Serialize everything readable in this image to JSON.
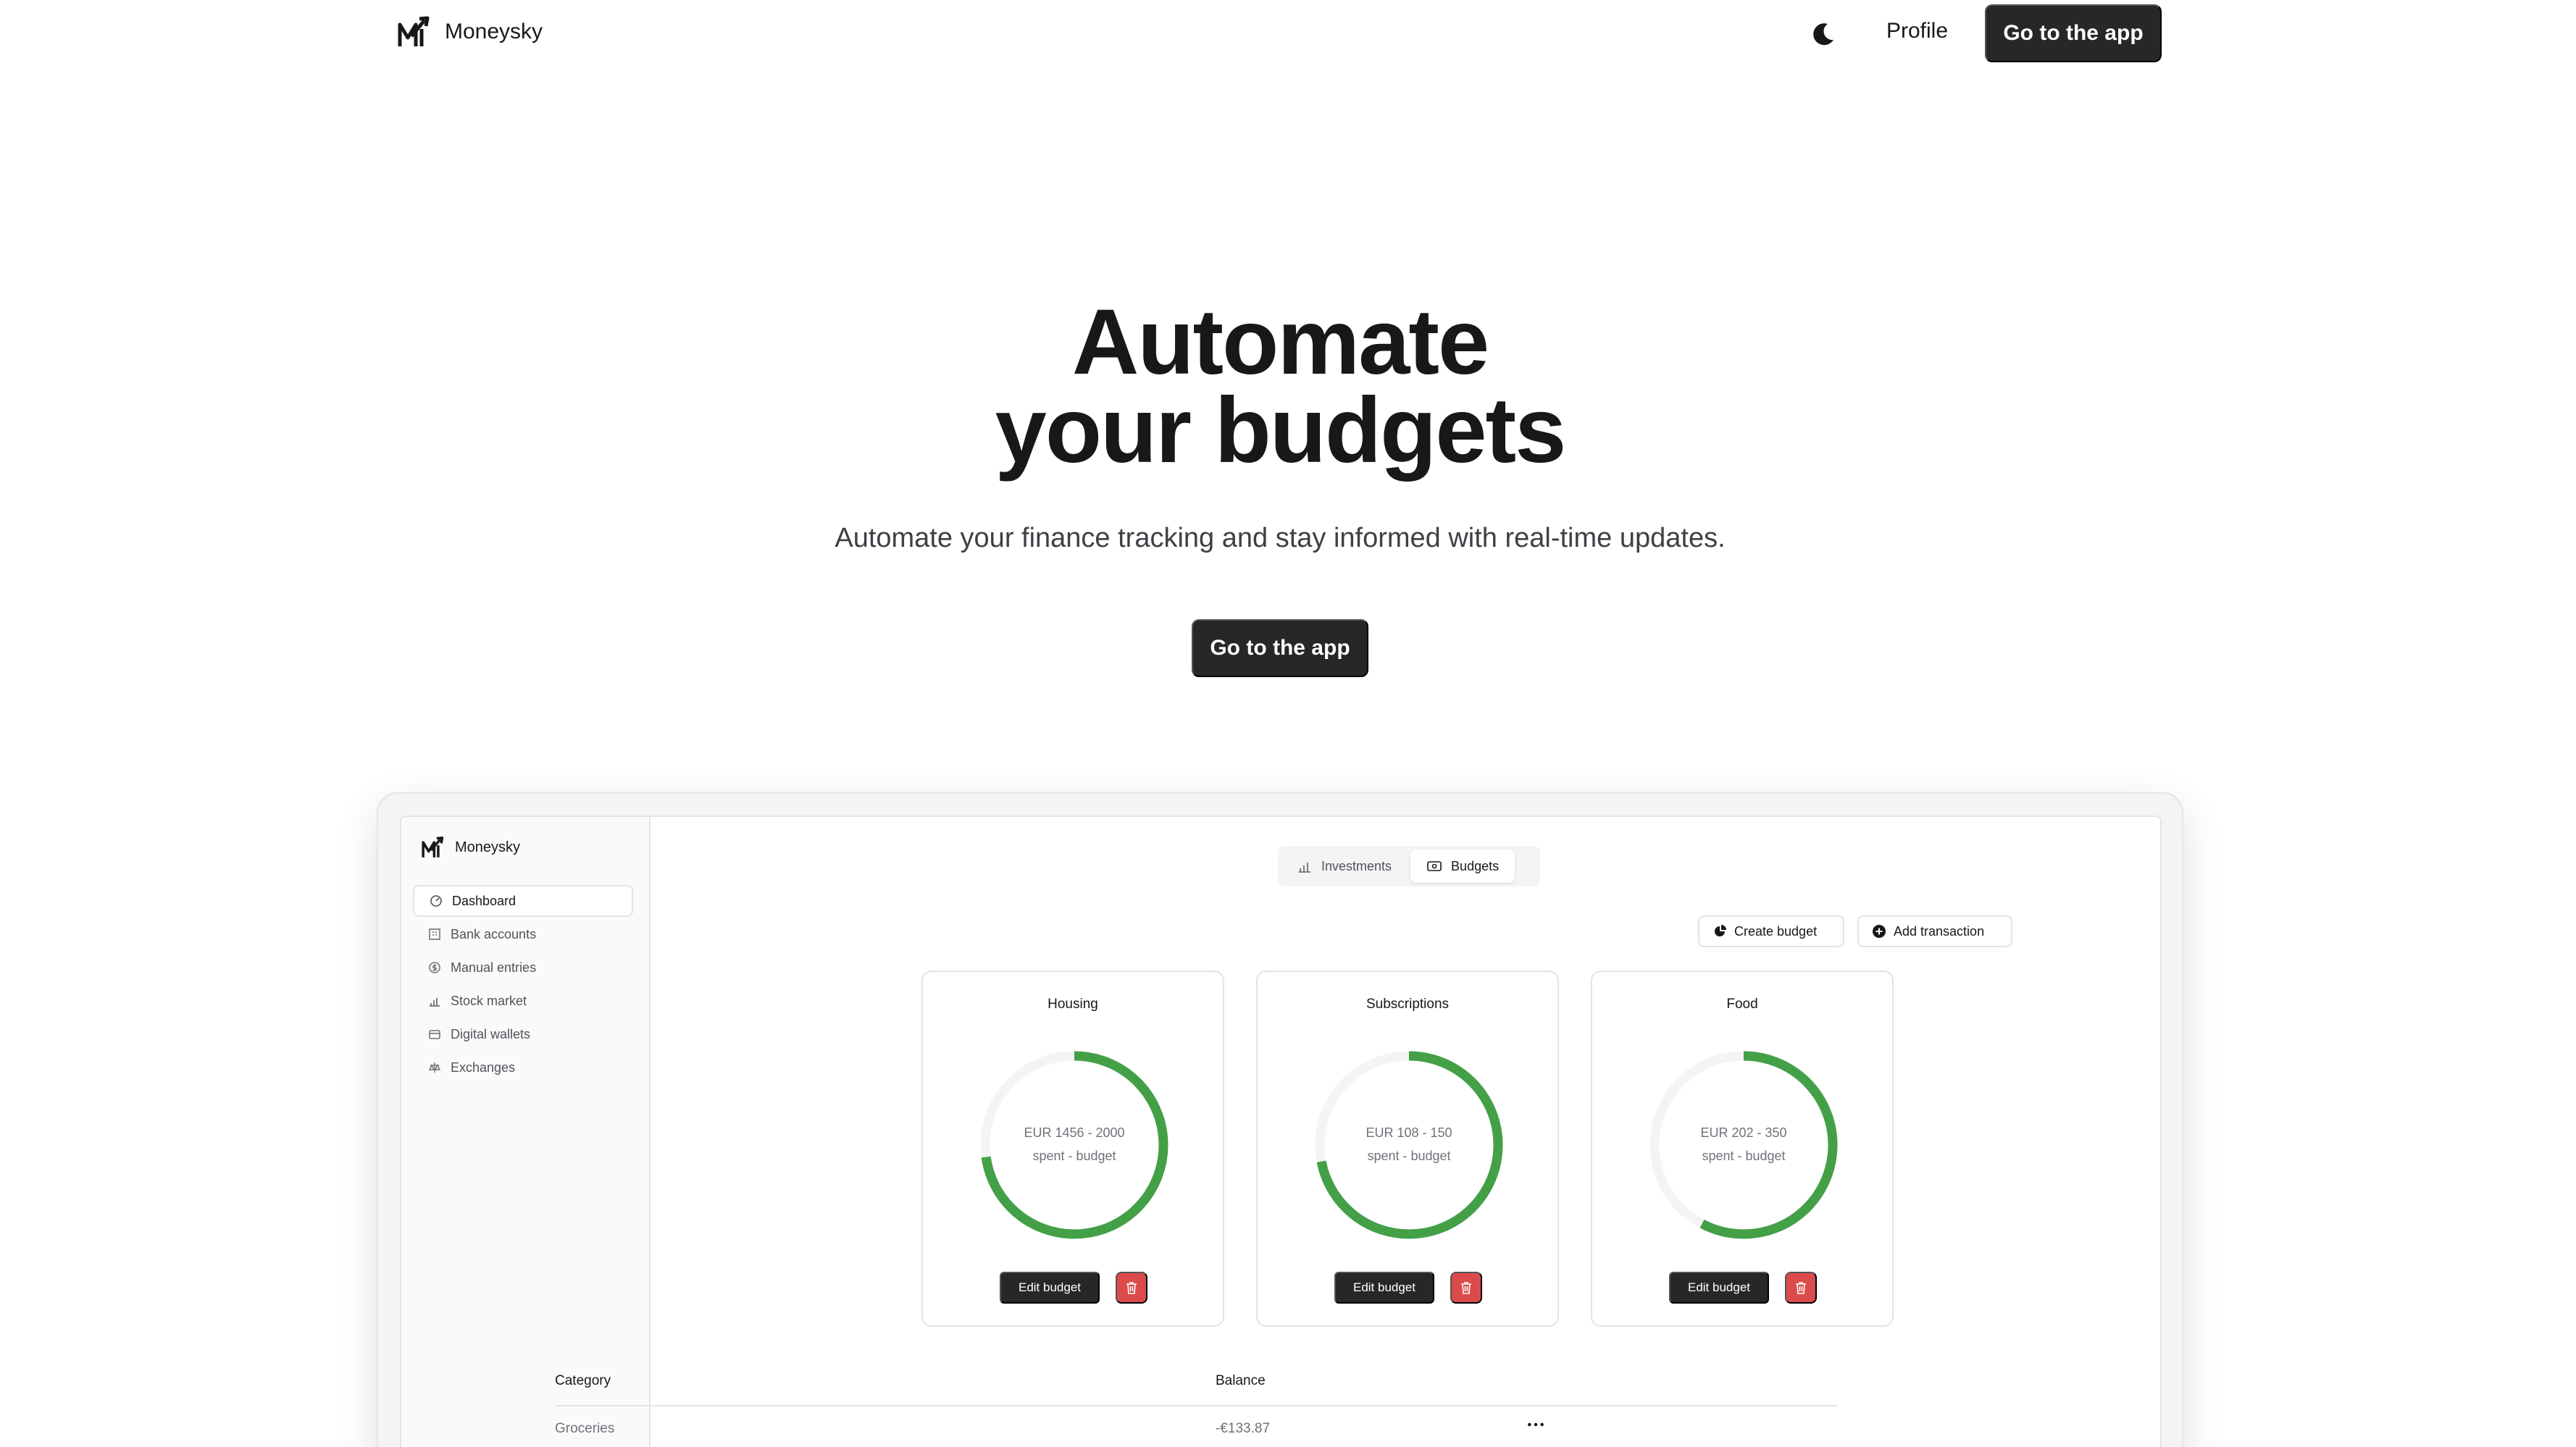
{
  "header": {
    "brand": "Moneysky",
    "profile_label": "Profile",
    "cta_label": "Go to the app"
  },
  "hero": {
    "title_line1": "Automate",
    "title_line2": "your budgets",
    "subtitle": "Automate your finance tracking and stay informed with real-time updates.",
    "cta_label": "Go to the app"
  },
  "app": {
    "brand": "Moneysky",
    "sidebar": {
      "items": [
        {
          "label": "Dashboard",
          "icon": "dashboard-icon",
          "active": true
        },
        {
          "label": "Bank accounts",
          "icon": "bank-icon",
          "active": false
        },
        {
          "label": "Manual entries",
          "icon": "dollar-circle-icon",
          "active": false
        },
        {
          "label": "Stock market",
          "icon": "bar-chart-icon",
          "active": false
        },
        {
          "label": "Digital wallets",
          "icon": "wallet-icon",
          "active": false
        },
        {
          "label": "Exchanges",
          "icon": "exchange-icon",
          "active": false
        }
      ]
    },
    "tabs": [
      {
        "label": "Investments",
        "icon": "bar-chart-icon",
        "active": false
      },
      {
        "label": "Budgets",
        "icon": "banknote-icon",
        "active": true
      }
    ],
    "actions": {
      "create_budget": "Create budget",
      "add_transaction": "Add transaction"
    },
    "budgets": [
      {
        "title": "Housing",
        "summary": "EUR 1456 - 2000",
        "caption": "spent - budget",
        "spent": 1456,
        "budget": 2000,
        "edit_label": "Edit budget"
      },
      {
        "title": "Subscriptions",
        "summary": "EUR 108 - 150",
        "caption": "spent - budget",
        "spent": 108,
        "budget": 150,
        "edit_label": "Edit budget"
      },
      {
        "title": "Food",
        "summary": "EUR 202 - 350",
        "caption": "spent - budget",
        "spent": 202,
        "budget": 350,
        "edit_label": "Edit budget"
      }
    ],
    "table": {
      "columns": [
        "Category",
        "Balance"
      ],
      "rows": [
        {
          "category": "Groceries",
          "balance": "-€133.87"
        }
      ]
    },
    "colors": {
      "progress": "#43a047",
      "track": "#f4f4f5",
      "danger": "#dc4b4b",
      "dark": "#27272a"
    }
  }
}
